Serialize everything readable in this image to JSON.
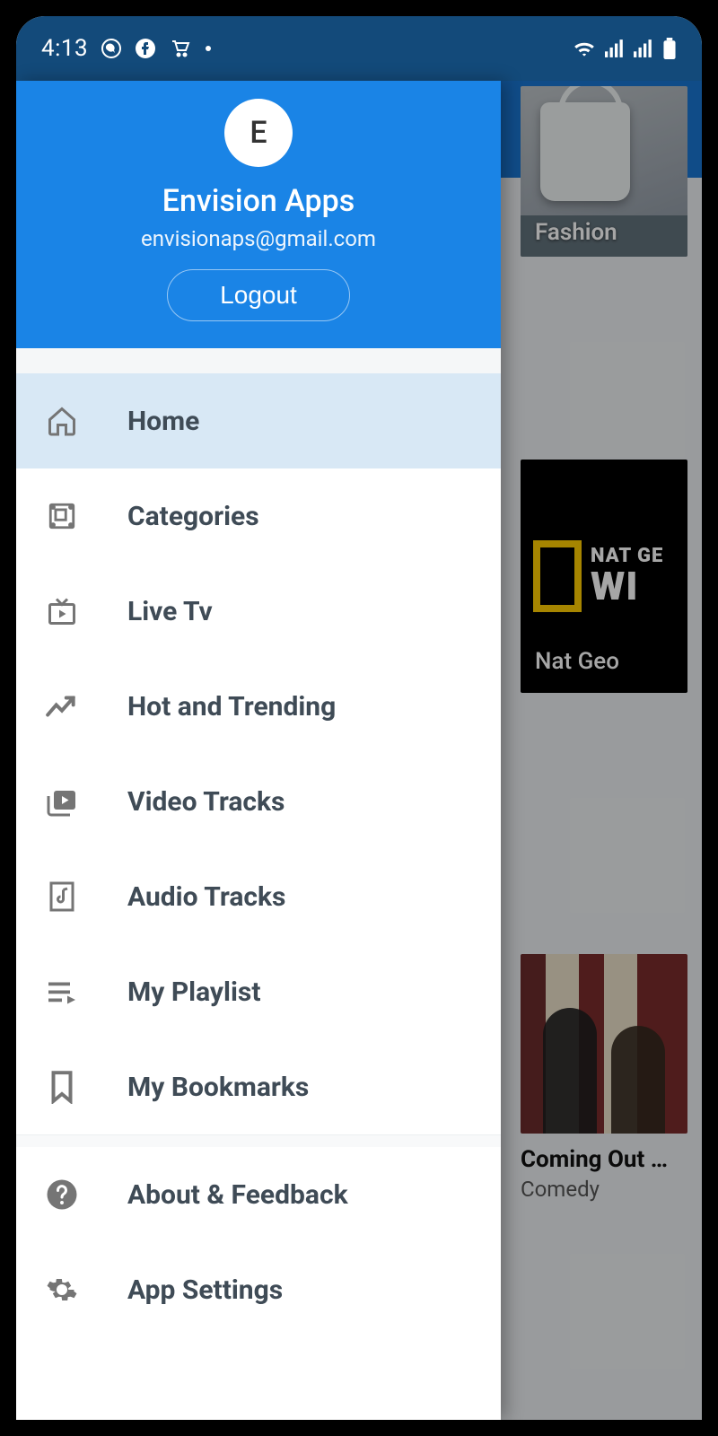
{
  "status": {
    "time": "4:13",
    "icons_left": [
      "whatsapp",
      "facebook",
      "cart",
      "dot"
    ],
    "icons_right": [
      "wifi",
      "signal1",
      "signal2",
      "battery"
    ]
  },
  "header_actions": {
    "download": "cloud-download",
    "search": "search"
  },
  "drawer": {
    "avatar_letter": "E",
    "user_name": "Envision Apps",
    "user_email": "envisionaps@gmail.com",
    "logout_label": "Logout"
  },
  "menu": [
    {
      "id": "home",
      "label": "Home",
      "icon": "home",
      "active": true
    },
    {
      "id": "categories",
      "label": "Categories",
      "icon": "categories",
      "active": false
    },
    {
      "id": "livetv",
      "label": "Live Tv",
      "icon": "livetv",
      "active": false
    },
    {
      "id": "hot",
      "label": "Hot and Trending",
      "icon": "trending",
      "active": false
    },
    {
      "id": "video",
      "label": "Video Tracks",
      "icon": "video",
      "active": false
    },
    {
      "id": "audio",
      "label": "Audio Tracks",
      "icon": "audio",
      "active": false
    },
    {
      "id": "playlist",
      "label": "My Playlist",
      "icon": "playlist",
      "active": false
    },
    {
      "id": "bookmarks",
      "label": "My Bookmarks",
      "icon": "bookmark",
      "active": false
    }
  ],
  "menu_footer": [
    {
      "id": "about",
      "label": "About & Feedback",
      "icon": "help"
    },
    {
      "id": "settings",
      "label": "App Settings",
      "icon": "settings"
    }
  ],
  "content": {
    "tile1": {
      "caption": "Fashion"
    },
    "tile2": {
      "caption": "Nat Geo",
      "brand_top": "NAT GE",
      "brand_bottom": "WI"
    },
    "tile3": {
      "title": "Coming Out …",
      "subtitle": "Comedy"
    }
  }
}
